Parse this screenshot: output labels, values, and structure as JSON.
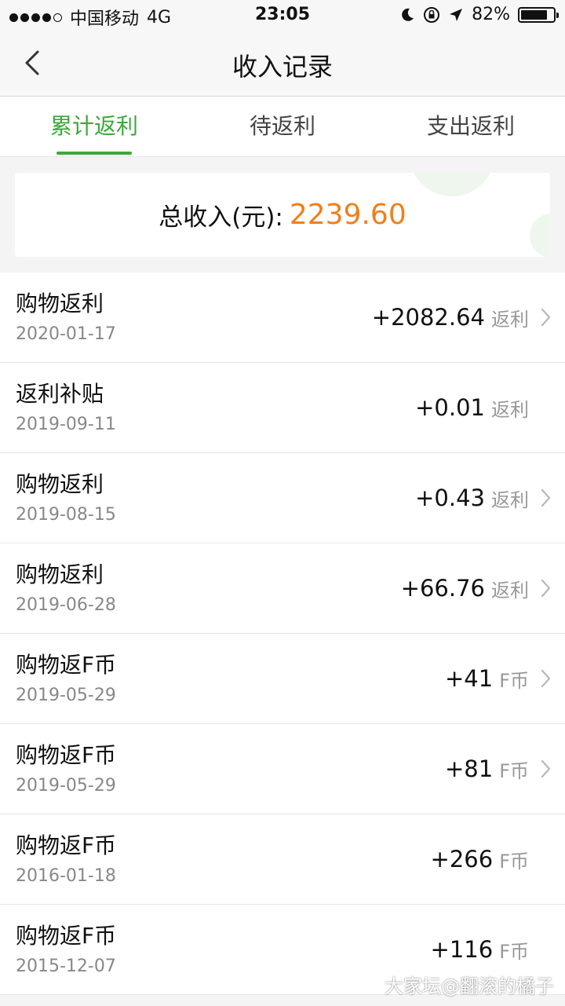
{
  "status_bar": {
    "carrier": "中国移动",
    "network": "4G",
    "time": "23:05",
    "battery": "82%",
    "battery_level": 0.82
  },
  "nav": {
    "title": "收入记录"
  },
  "tabs": [
    {
      "label": "累计返利",
      "active": true
    },
    {
      "label": "待返利",
      "active": false
    },
    {
      "label": "支出返利",
      "active": false
    }
  ],
  "summary": {
    "label": "总收入(元):",
    "value": "2239.60"
  },
  "records": [
    {
      "title": "购物返利",
      "date": "2020-01-17",
      "amount": "+2082.64",
      "unit": "返利",
      "has_arrow": true
    },
    {
      "title": "返利补贴",
      "date": "2019-09-11",
      "amount": "+0.01",
      "unit": "返利",
      "has_arrow": false
    },
    {
      "title": "购物返利",
      "date": "2019-08-15",
      "amount": "+0.43",
      "unit": "返利",
      "has_arrow": true
    },
    {
      "title": "购物返利",
      "date": "2019-06-28",
      "amount": "+66.76",
      "unit": "返利",
      "has_arrow": true
    },
    {
      "title": "购物返F币",
      "date": "2019-05-29",
      "amount": "+41",
      "unit": "F币",
      "has_arrow": true
    },
    {
      "title": "购物返F币",
      "date": "2019-05-29",
      "amount": "+81",
      "unit": "F币",
      "has_arrow": true
    },
    {
      "title": "购物返F币",
      "date": "2016-01-18",
      "amount": "+266",
      "unit": "F币",
      "has_arrow": false
    },
    {
      "title": "购物返F币",
      "date": "2015-12-07",
      "amount": "+116",
      "unit": "F币",
      "has_arrow": false
    }
  ],
  "watermark": "大家坛@翻滚的橘子",
  "colors": {
    "accent_green": "#3aa93a",
    "amount_orange": "#f07f1b"
  }
}
